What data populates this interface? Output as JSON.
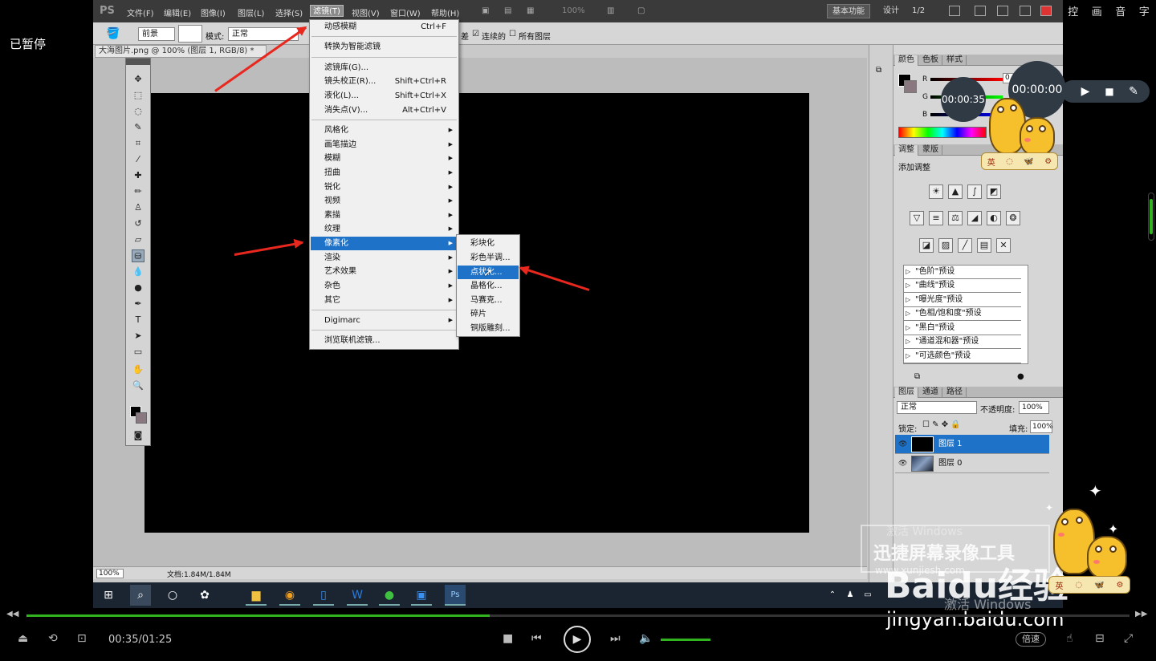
{
  "player": {
    "paused_label": "已暂停",
    "side_tools": [
      "控",
      "画",
      "音",
      "字"
    ],
    "current_time": "00:35/01:25",
    "speed_label": "倍速",
    "progress_fraction": 0.42
  },
  "recorder": {
    "small_timer": "00:00:35",
    "main_timer": "00:00:00"
  },
  "ps": {
    "logo": "PS",
    "menus": [
      "文件(F)",
      "编辑(E)",
      "图像(I)",
      "图层(L)",
      "选择(S)",
      "滤镜(T)",
      "视图(V)",
      "窗口(W)",
      "帮助(H)"
    ],
    "zoom_menu": "100%",
    "workspace_btn": "基本功能",
    "design_btn": "设计",
    "more_btn": "1/2",
    "options": {
      "fill_source": "前景",
      "mode_label": "模式:",
      "mode_value": "正常",
      "contiguous": "连续的",
      "all_layers": "所有图层",
      "tolerance_fragment": "差"
    },
    "doc_tab": "大海图片.png @ 100% (图层 1, RGB/8) *",
    "status_zoom": "100%",
    "status_doc": "文档:1.84M/1.84M",
    "color_tabs": [
      "颜色",
      "色板",
      "样式"
    ],
    "color_r_value": "0",
    "adj_tabs": [
      "调整",
      "蒙版"
    ],
    "adj_title": "添加调整",
    "presets": [
      "\"色阶\"预设",
      "\"曲线\"预设",
      "\"曝光度\"预设",
      "\"色相/饱和度\"预设",
      "\"黑白\"预设",
      "\"通道混和器\"预设",
      "\"可选颜色\"预设"
    ],
    "layer_tabs": [
      "图层",
      "通道",
      "路径"
    ],
    "blend_mode": "正常",
    "opacity_label": "不透明度:",
    "opacity_value": "100%",
    "lock_label": "锁定:",
    "fill_label": "填充:",
    "fill_value": "100%",
    "layers": [
      "图层 1",
      "图层 0"
    ]
  },
  "filter_menu": {
    "last_filter": "动感模糊",
    "last_filter_sc": "Ctrl+F",
    "convert_smart": "转换为智能滤镜",
    "gallery": "滤镜库(G)...",
    "lens": "镜头校正(R)...",
    "lens_sc": "Shift+Ctrl+R",
    "liquify": "液化(L)...",
    "liquify_sc": "Shift+Ctrl+X",
    "vanish": "消失点(V)...",
    "vanish_sc": "Alt+Ctrl+V",
    "groups": [
      "风格化",
      "画笔描边",
      "模糊",
      "扭曲",
      "锐化",
      "视频",
      "素描",
      "纹理",
      "像素化",
      "渲染",
      "艺术效果",
      "杂色",
      "其它"
    ],
    "digimarc": "Digimarc",
    "browse": "浏览联机滤镜..."
  },
  "pixelate_submenu": [
    "彩块化",
    "彩色半调...",
    "点状化...",
    "晶格化...",
    "马赛克...",
    "碎片",
    "铜版雕刻..."
  ],
  "mascot": {
    "badges": [
      "英",
      "◌",
      "🦋",
      "⚙"
    ]
  },
  "watermarks": {
    "activate": "激活 Windows",
    "recorder_brand": "迅捷屏幕录像工具",
    "recorder_url": "www.xunjiesh.com",
    "baidu": "Baidu经验",
    "baidu_url": "jingyan.baidu.com",
    "activate2": "激活 Windows"
  }
}
